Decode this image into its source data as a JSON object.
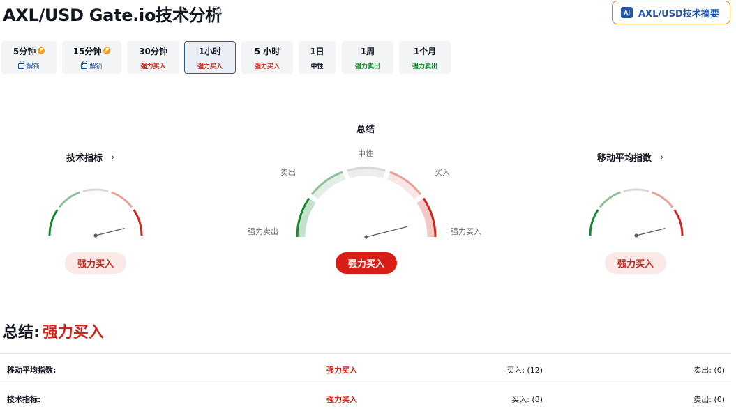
{
  "header": {
    "title": "AXL/USD Gate.io技术分析",
    "ai_button_label": "AXL/USD技术摘要",
    "ai_icon_text": "AI"
  },
  "tabs": [
    {
      "label": "5分钟",
      "sub": "解锁",
      "locked": true
    },
    {
      "label": "15分钟",
      "sub": "解锁",
      "locked": true
    },
    {
      "label": "30分钟",
      "sub": "强力买入",
      "color": "#d0261a"
    },
    {
      "label": "1小时",
      "sub": "强力买入",
      "color": "#d0261a",
      "active": true
    },
    {
      "label": "5 小时",
      "sub": "强力买入",
      "color": "#d0261a"
    },
    {
      "label": "1日",
      "sub": "中性",
      "color": "#131722"
    },
    {
      "label": "1周",
      "sub": "强力卖出",
      "color": "#138a2f"
    },
    {
      "label": "1个月",
      "sub": "强力卖出",
      "color": "#138a2f"
    }
  ],
  "gauges": {
    "technical": {
      "title": "技术指标",
      "result": "强力买入"
    },
    "summary": {
      "title": "总结",
      "result": "强力买入",
      "labels": {
        "neutral": "中性",
        "sell": "卖出",
        "buy": "买入",
        "strong_sell": "强力卖出",
        "strong_buy": "强力买入"
      }
    },
    "moving_averages": {
      "title": "移动平均指数",
      "result": "强力买入"
    }
  },
  "summary": {
    "heading": "总结:",
    "value": "强力买入",
    "rows": [
      {
        "name": "移动平均指数:",
        "signal": "强力买入",
        "buy": "买入: (12)",
        "sell": "卖出: (0)"
      },
      {
        "name": "技术指标:",
        "signal": "强力买入",
        "buy": "买入: (8)",
        "sell": "卖出: (0)"
      }
    ]
  },
  "colors": {
    "strong_sell": "#138a2f",
    "sell": "#8fbf9a",
    "neutral": "#d6d7da",
    "buy": "#e8a09a",
    "strong_buy": "#d0261a",
    "accent": "#2455a4"
  },
  "icons": [
    "info-icon",
    "ai-icon",
    "pro-icon",
    "lock-icon",
    "chevron-right-icon"
  ]
}
